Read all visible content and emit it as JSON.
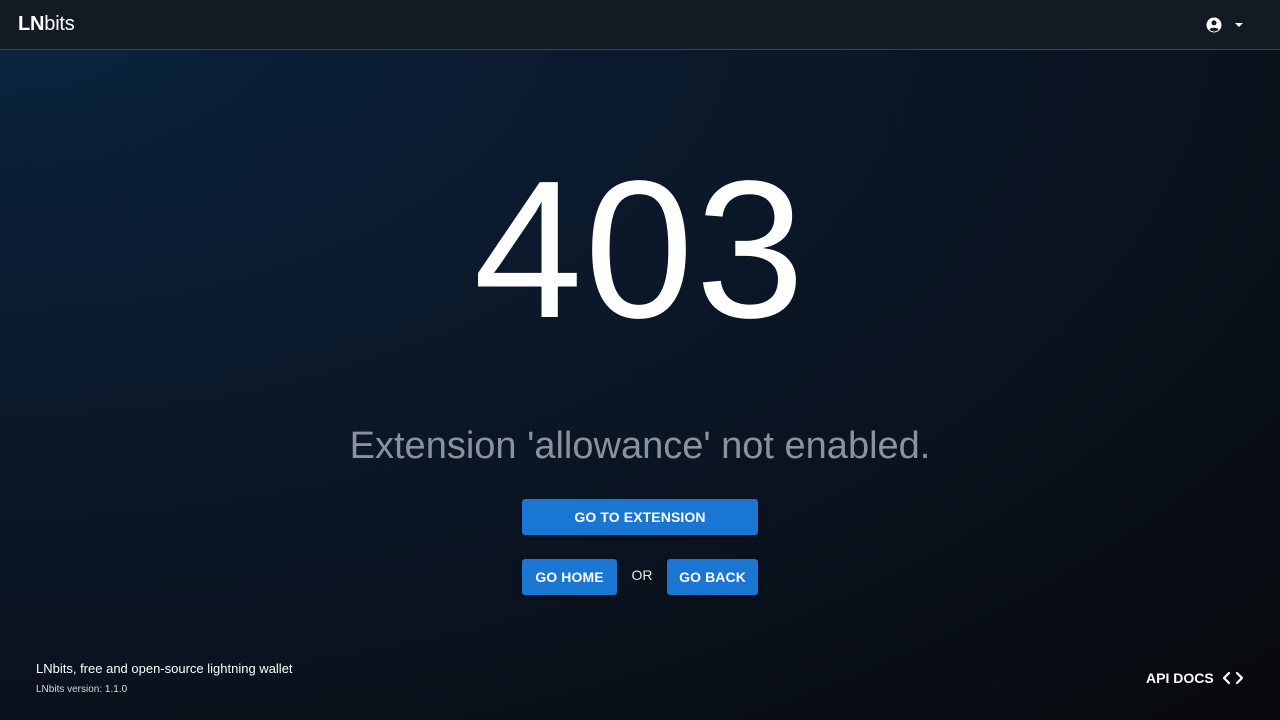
{
  "header": {
    "brand_bold": "LN",
    "brand_rest": "bits",
    "account_icon": "account-circle-icon",
    "dropdown_icon": "caret-down-icon"
  },
  "error": {
    "code": "403",
    "message": "Extension 'allowance' not enabled."
  },
  "actions": {
    "go_to_extension": "GO TO EXTENSION",
    "go_home": "GO HOME",
    "or": "OR",
    "go_back": "GO BACK"
  },
  "footer": {
    "description": "LNbits, free and open-source lightning wallet",
    "version": "LNbits version: 1.1.0",
    "api_docs": "API DOCS",
    "api_docs_icon": "code-icon"
  },
  "colors": {
    "primary": "#1976d2",
    "header_bg": "#121a24",
    "message_text": "#8a929c"
  }
}
